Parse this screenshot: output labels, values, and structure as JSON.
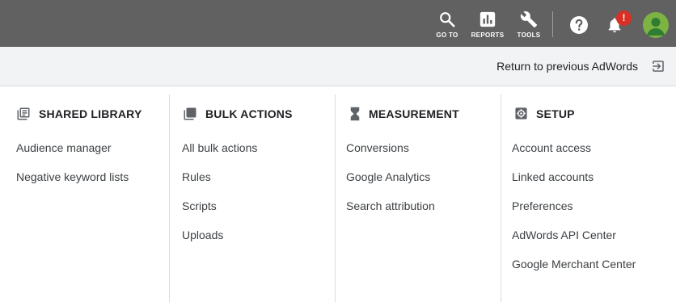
{
  "topbar": {
    "goto_label": "GO TO",
    "reports_label": "REPORTS",
    "tools_label": "TOOLS",
    "notification_badge": "!",
    "icons": {
      "goto": "search-icon",
      "reports": "bar-chart-icon",
      "tools": "wrench-icon",
      "help": "help-circle-icon",
      "notifications": "bell-icon",
      "account": "avatar-icon"
    }
  },
  "return_bar": {
    "label": "Return to previous AdWords",
    "icon": "exit-to-app-icon"
  },
  "menu": {
    "shared_library": {
      "title": "SHARED LIBRARY",
      "icon": "library-icon",
      "items": [
        "Audience manager",
        "Negative keyword lists"
      ]
    },
    "bulk_actions": {
      "title": "BULK ACTIONS",
      "icon": "copy-stack-icon",
      "items": [
        "All bulk actions",
        "Rules",
        "Scripts",
        "Uploads"
      ]
    },
    "measurement": {
      "title": "MEASUREMENT",
      "icon": "hourglass-icon",
      "items": [
        "Conversions",
        "Google Analytics",
        "Search attribution"
      ]
    },
    "setup": {
      "title": "SETUP",
      "icon": "gear-box-icon",
      "items": [
        "Account access",
        "Linked accounts",
        "Preferences",
        "AdWords API Center",
        "Google Merchant Center"
      ]
    }
  },
  "colors": {
    "topbar_bg": "#616161",
    "return_bar_bg": "#f1f3f4",
    "badge_red": "#d93025",
    "avatar_green": "#7cb342",
    "divider": "#dadce0"
  }
}
